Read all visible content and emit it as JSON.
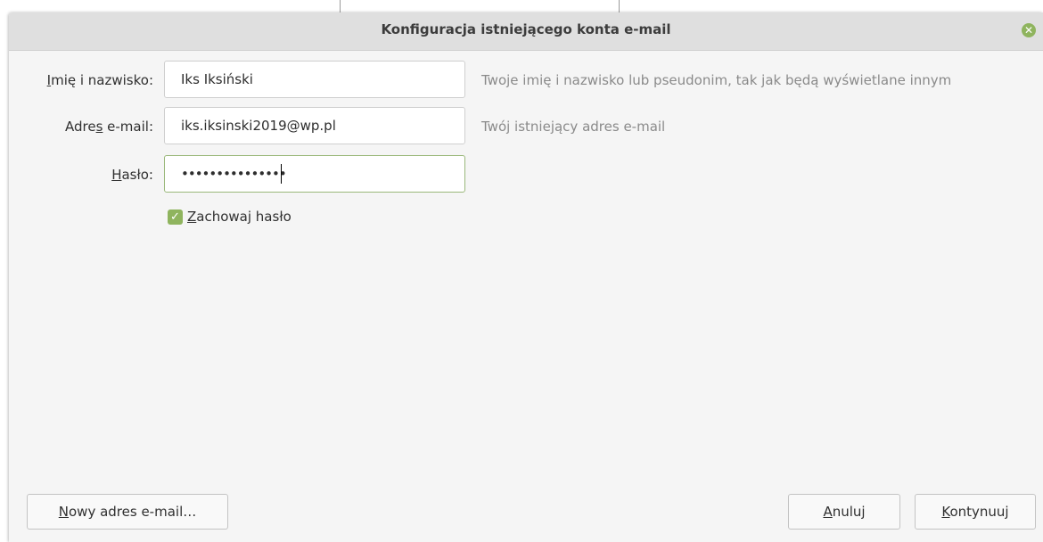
{
  "dialog": {
    "title": "Konfiguracja istniejącego konta e-mail"
  },
  "form": {
    "name": {
      "label_mnemonic": "I",
      "label_rest": "mię i nazwisko:",
      "value": "Iks Iksiński",
      "hint": "Twoje imię i nazwisko lub pseudonim, tak jak będą wyświetlane innym"
    },
    "email": {
      "label_before": "Adre",
      "label_mnemonic": "s",
      "label_after": " e-mail:",
      "value": "iks.iksinski2019@wp.pl",
      "hint": "Twój istniejący adres e-mail"
    },
    "password": {
      "label_mnemonic": "H",
      "label_rest": "asło:",
      "value": "•••••••••••••••"
    },
    "remember": {
      "checked": true,
      "label_mnemonic": "Z",
      "label_rest": "achowaj hasło"
    }
  },
  "buttons": {
    "new_address": {
      "mnemonic": "N",
      "rest": "owy adres e-mail…"
    },
    "cancel": {
      "mnemonic": "A",
      "rest": "nuluj"
    },
    "continue": {
      "mnemonic": "K",
      "rest": "ontynuuj"
    }
  },
  "colors": {
    "accent": "#8fb45e",
    "titlebar": "#dfdfdf",
    "dialog_bg": "#f5f5f5",
    "hint_text": "#8a8a8a"
  },
  "icons": {
    "close": "close-icon",
    "checkbox": "checkmark-icon"
  }
}
